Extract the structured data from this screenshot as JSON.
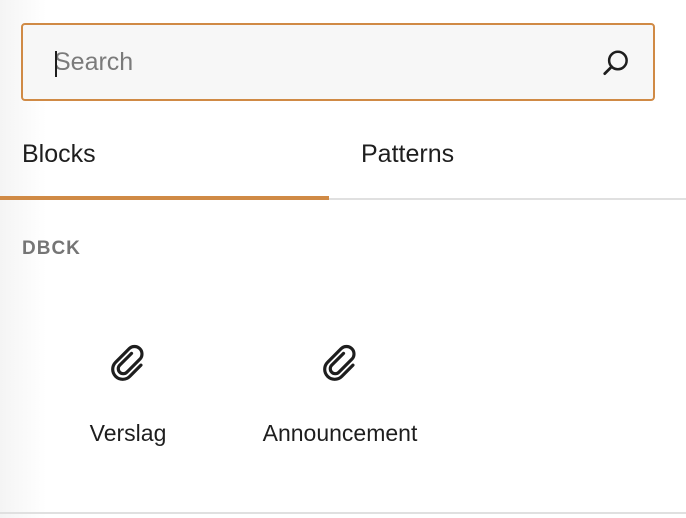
{
  "search": {
    "placeholder": "Search",
    "value": ""
  },
  "tabs": [
    {
      "label": "Blocks",
      "selected": true
    },
    {
      "label": "Patterns",
      "selected": false
    }
  ],
  "category": {
    "title": "DBCK",
    "items": [
      {
        "label": "Verslag",
        "icon": "paperclip-icon"
      },
      {
        "label": "Announcement",
        "icon": "paperclip-icon"
      }
    ]
  },
  "colors": {
    "accent": "#d08a45",
    "text": "#1e1e1e",
    "muted": "#757575",
    "divider": "#e0e0e0"
  }
}
